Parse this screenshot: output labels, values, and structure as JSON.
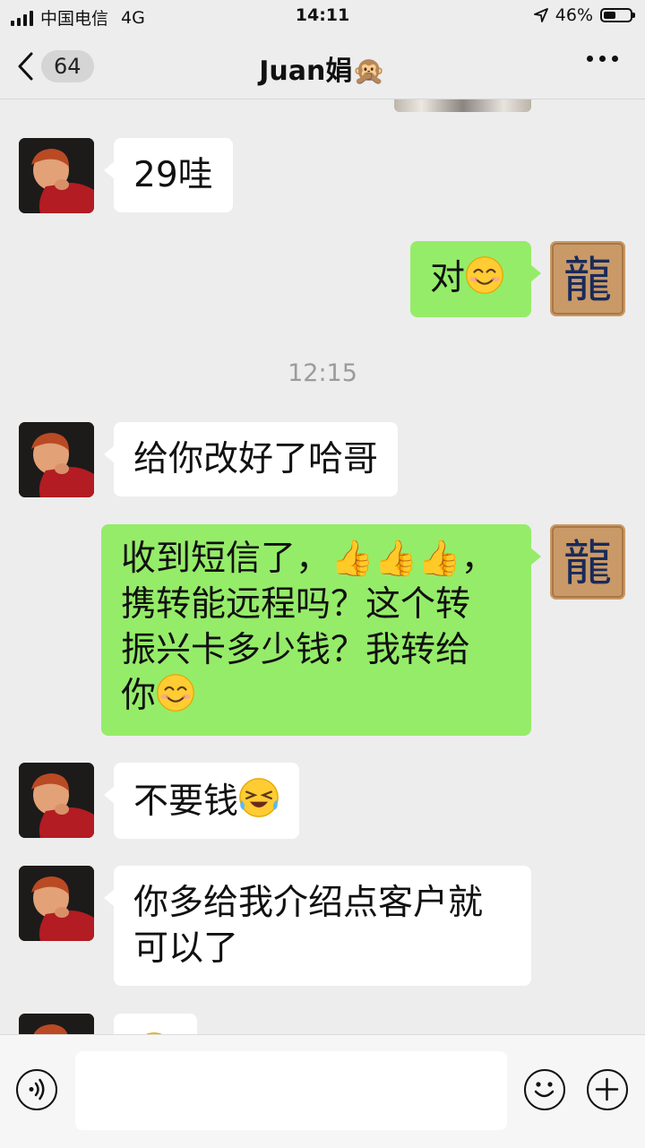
{
  "status_bar": {
    "carrier": "中国电信",
    "network": "4G",
    "time": "14:11",
    "battery": "46%",
    "battery_level": 0.46
  },
  "nav": {
    "back_badge": "64",
    "title": "Juan娟🙊"
  },
  "chat": {
    "messages": [
      {
        "sender": "contact",
        "text": "29哇"
      },
      {
        "sender": "me",
        "text": "对",
        "emoji": "smiling-face-icon"
      },
      {
        "sender": "contact",
        "text": "给你改好了哈哥"
      },
      {
        "sender": "me",
        "text": "收到短信了，👍👍👍，\n携转能远程吗？这个转\n振兴卡多少钱？我转给\n你",
        "emoji": "smiling-face-icon"
      },
      {
        "sender": "contact",
        "text": "不要钱",
        "emoji": "laughing-tears-icon"
      },
      {
        "sender": "contact",
        "text": "你多给我介绍点客户就\n可以了"
      }
    ],
    "time_separator": "12:15",
    "my_avatar_text": "龍"
  },
  "colors": {
    "background": "#ededed",
    "incoming_bubble": "#ffffff",
    "outgoing_bubble": "#95ec69"
  },
  "input": {
    "placeholder": ""
  }
}
